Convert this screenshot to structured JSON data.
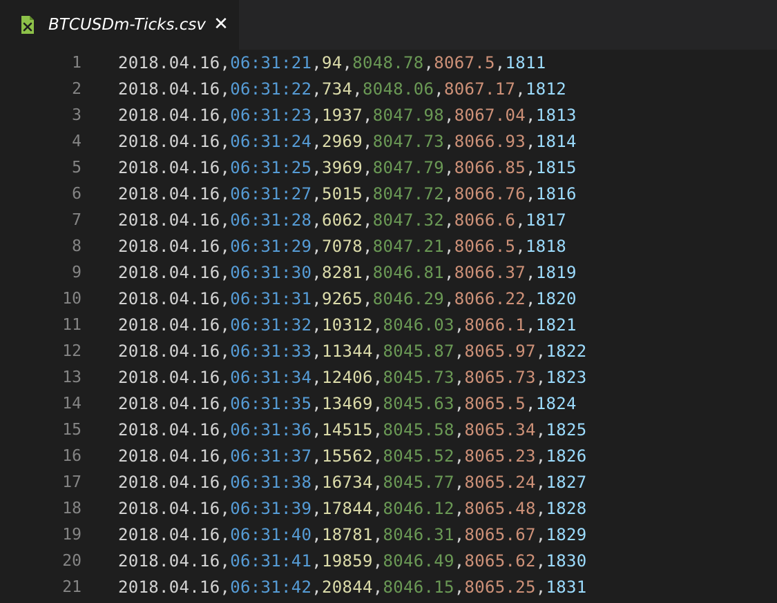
{
  "tab": {
    "title": "BTCUSDm-Ticks.csv",
    "icon": "csv-file-icon",
    "close_label": "✕"
  },
  "colors": {
    "date": "#d4d4d4",
    "time": "#569cd6",
    "volume": "#dcdcaa",
    "bid": "#6a9955",
    "ask": "#ce9178",
    "id": "#9cdcfe",
    "line_number": "#858585",
    "background": "#1e1e1e"
  },
  "rows": [
    {
      "ln": "1",
      "date": "2018.04.16",
      "time": "06:31:21",
      "vol": "94",
      "bid": "8048.78",
      "ask": "8067.5",
      "id": "1811"
    },
    {
      "ln": "2",
      "date": "2018.04.16",
      "time": "06:31:22",
      "vol": "734",
      "bid": "8048.06",
      "ask": "8067.17",
      "id": "1812"
    },
    {
      "ln": "3",
      "date": "2018.04.16",
      "time": "06:31:23",
      "vol": "1937",
      "bid": "8047.98",
      "ask": "8067.04",
      "id": "1813"
    },
    {
      "ln": "4",
      "date": "2018.04.16",
      "time": "06:31:24",
      "vol": "2969",
      "bid": "8047.73",
      "ask": "8066.93",
      "id": "1814"
    },
    {
      "ln": "5",
      "date": "2018.04.16",
      "time": "06:31:25",
      "vol": "3969",
      "bid": "8047.79",
      "ask": "8066.85",
      "id": "1815"
    },
    {
      "ln": "6",
      "date": "2018.04.16",
      "time": "06:31:27",
      "vol": "5015",
      "bid": "8047.72",
      "ask": "8066.76",
      "id": "1816"
    },
    {
      "ln": "7",
      "date": "2018.04.16",
      "time": "06:31:28",
      "vol": "6062",
      "bid": "8047.32",
      "ask": "8066.6",
      "id": "1817"
    },
    {
      "ln": "8",
      "date": "2018.04.16",
      "time": "06:31:29",
      "vol": "7078",
      "bid": "8047.21",
      "ask": "8066.5",
      "id": "1818"
    },
    {
      "ln": "9",
      "date": "2018.04.16",
      "time": "06:31:30",
      "vol": "8281",
      "bid": "8046.81",
      "ask": "8066.37",
      "id": "1819"
    },
    {
      "ln": "10",
      "date": "2018.04.16",
      "time": "06:31:31",
      "vol": "9265",
      "bid": "8046.29",
      "ask": "8066.22",
      "id": "1820"
    },
    {
      "ln": "11",
      "date": "2018.04.16",
      "time": "06:31:32",
      "vol": "10312",
      "bid": "8046.03",
      "ask": "8066.1",
      "id": "1821"
    },
    {
      "ln": "12",
      "date": "2018.04.16",
      "time": "06:31:33",
      "vol": "11344",
      "bid": "8045.87",
      "ask": "8065.97",
      "id": "1822"
    },
    {
      "ln": "13",
      "date": "2018.04.16",
      "time": "06:31:34",
      "vol": "12406",
      "bid": "8045.73",
      "ask": "8065.73",
      "id": "1823"
    },
    {
      "ln": "14",
      "date": "2018.04.16",
      "time": "06:31:35",
      "vol": "13469",
      "bid": "8045.63",
      "ask": "8065.5",
      "id": "1824"
    },
    {
      "ln": "15",
      "date": "2018.04.16",
      "time": "06:31:36",
      "vol": "14515",
      "bid": "8045.58",
      "ask": "8065.34",
      "id": "1825"
    },
    {
      "ln": "16",
      "date": "2018.04.16",
      "time": "06:31:37",
      "vol": "15562",
      "bid": "8045.52",
      "ask": "8065.23",
      "id": "1826"
    },
    {
      "ln": "17",
      "date": "2018.04.16",
      "time": "06:31:38",
      "vol": "16734",
      "bid": "8045.77",
      "ask": "8065.24",
      "id": "1827"
    },
    {
      "ln": "18",
      "date": "2018.04.16",
      "time": "06:31:39",
      "vol": "17844",
      "bid": "8046.12",
      "ask": "8065.48",
      "id": "1828"
    },
    {
      "ln": "19",
      "date": "2018.04.16",
      "time": "06:31:40",
      "vol": "18781",
      "bid": "8046.31",
      "ask": "8065.67",
      "id": "1829"
    },
    {
      "ln": "20",
      "date": "2018.04.16",
      "time": "06:31:41",
      "vol": "19859",
      "bid": "8046.49",
      "ask": "8065.62",
      "id": "1830"
    },
    {
      "ln": "21",
      "date": "2018.04.16",
      "time": "06:31:42",
      "vol": "20844",
      "bid": "8046.15",
      "ask": "8065.25",
      "id": "1831"
    }
  ]
}
